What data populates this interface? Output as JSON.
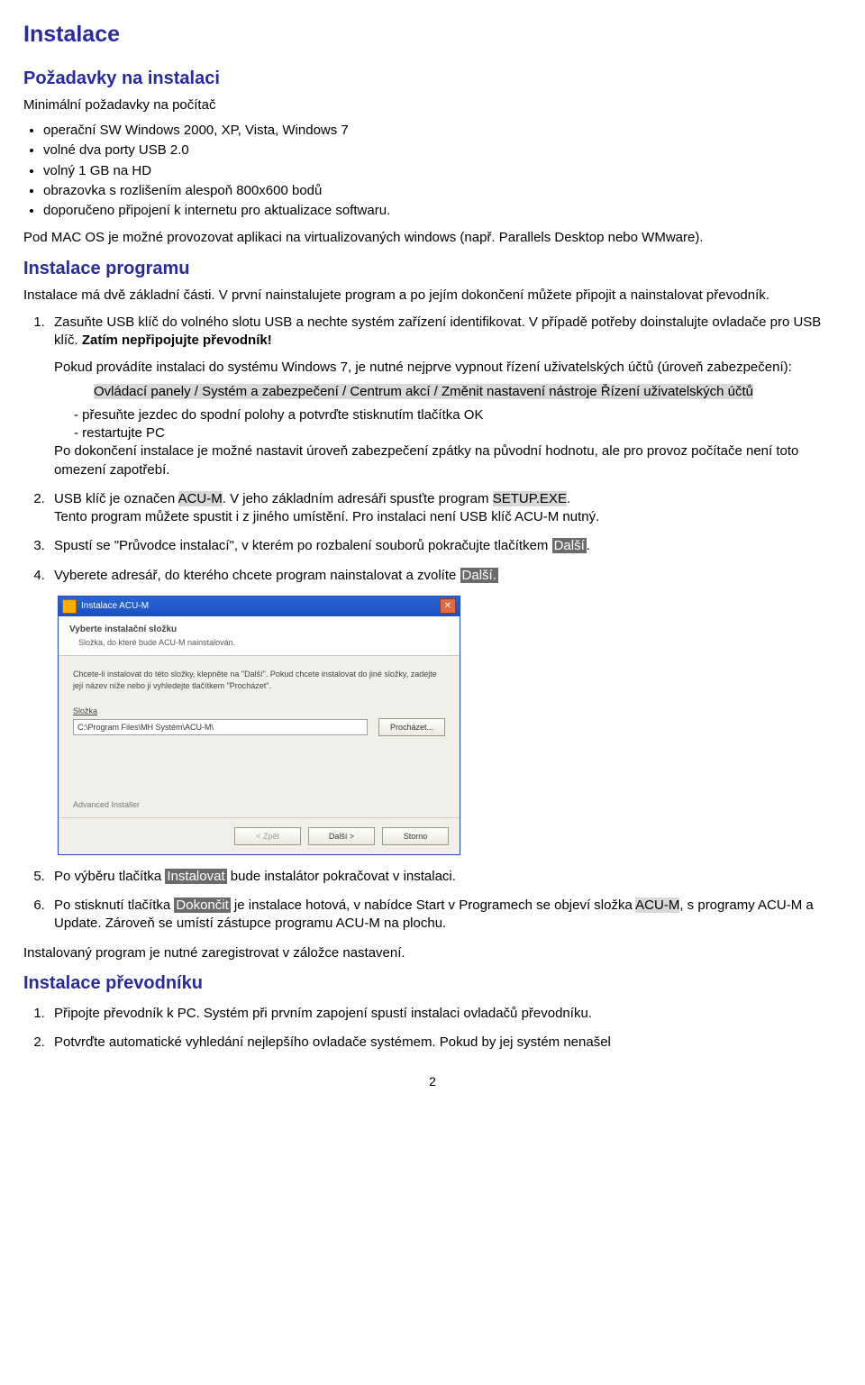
{
  "h_instalace": "Instalace",
  "h_pozadavky": "Požadavky na instalaci",
  "req_intro": "Minimální požadavky na počítač",
  "req_items": [
    "operační SW Windows 2000, XP, Vista, Windows 7",
    "volné dva porty  USB 2.0",
    "volný 1 GB na HD",
    "obrazovka s rozlišením alespoň 800x600 bodů",
    "doporučeno připojení k internetu pro aktualizace softwaru."
  ],
  "req_para": "Pod MAC OS je možné provozovat aplikaci na virtualizovaných windows (např. Parallels Desktop nebo WMware).",
  "h_instprog": "Instalace programu",
  "prog_intro": "Instalace má dvě základní části. V první nainstalujete program a po jejím dokončení můžete připojit a nainstalovat převodník.",
  "step1_a": "Zasuňte USB klíč do volného slotu USB a nechte systém zařízení identifikovat. V případě potřeby doinstalujte ovladače pro USB klíč. ",
  "step1_b_bold": "Zatím nepřipojujte převodník!",
  "step1_p1_a": "Pokud provádíte instalaci do systému ",
  "step1_p1_b": "Windows 7",
  "step1_p1_c": ", je nutné nejprve vypnout řízení uživatelských účtů (úroveň zabezpečení):",
  "step1_path_hl": "Ovládací panely / Systém a zabezpečení / Centrum akcí / Změnit nastavení nástroje Řízení uživatelských účtů",
  "step1_d1": "- přesuňte jezdec do spodní polohy a potvrďte stisknutím tlačítka OK",
  "step1_d2": "- restartujte PC",
  "step1_after": "Po dokončení instalace je možné nastavit úroveň zabezpečení zpátky na původní hodnotu, ale pro provoz počítače není toto omezení zapotřebí.",
  "step2_a": "USB klíč je označen ",
  "step2_hl1": "ACU-M",
  "step2_b": ". V jeho základním adresáři spusťte program ",
  "step2_hl2": "SETUP.EXE",
  "step2_c": ".",
  "step2_line2": "Tento program můžete spustit i z jiného umístění. Pro instalaci není USB klíč ACU-M nutný.",
  "step3_a": "Spustí se \"Průvodce instalací\", v kterém po rozbalení souborů pokračujte tlačítkem ",
  "step3_btn": "Další",
  "step3_b": ".",
  "step4_a": "Vyberete adresář, do kterého chcete program nainstalovat a zvolíte ",
  "step4_btn": "Další.",
  "installer": {
    "title": "Instalace ACU-M",
    "banner_title": "Vyberte instalační složku",
    "banner_sub": "Složka, do které bude ACU-M nainstalován.",
    "instr": "Chcete-li instalovat do této složky, klepněte na \"Další\". Pokud chcete instalovat do jiné složky, zadejte její název níže nebo ji vyhledejte tlačítkem \"Procházet\".",
    "folder_label": "Složka",
    "folder_value": "C:\\Program Files\\MH Systém\\ACU-M\\",
    "browse": "Procházet...",
    "adv": "Advanced Installer",
    "back": "< Zpět",
    "next": "Další >",
    "cancel": "Storno"
  },
  "step5_a": "Po výběru tlačítka ",
  "step5_btn": "Instalovat",
  "step5_b": " bude instalátor pokračovat v instalaci.",
  "step6_a": "Po stisknutí tlačítka ",
  "step6_btn": "Dokončit",
  "step6_b": " je instalace hotová, v nabídce Start v Programech se objeví složka ",
  "step6_hl": "ACU-M",
  "step6_c": ", s programy ACU-M a Update. Zároveň se umístí zástupce programu ACU-M na plochu.",
  "reg_note": "Instalovaný program je nutné zaregistrovat v záložce nastavení.",
  "h_prevodnik": "Instalace převodníku",
  "prev_steps": [
    "Připojte převodník k PC. Systém při prvním zapojení spustí instalaci ovladačů převodníku.",
    "Potvrďte automatické vyhledání nejlepšího ovladače systémem. Pokud by jej systém nenašel"
  ],
  "page_number": "2"
}
